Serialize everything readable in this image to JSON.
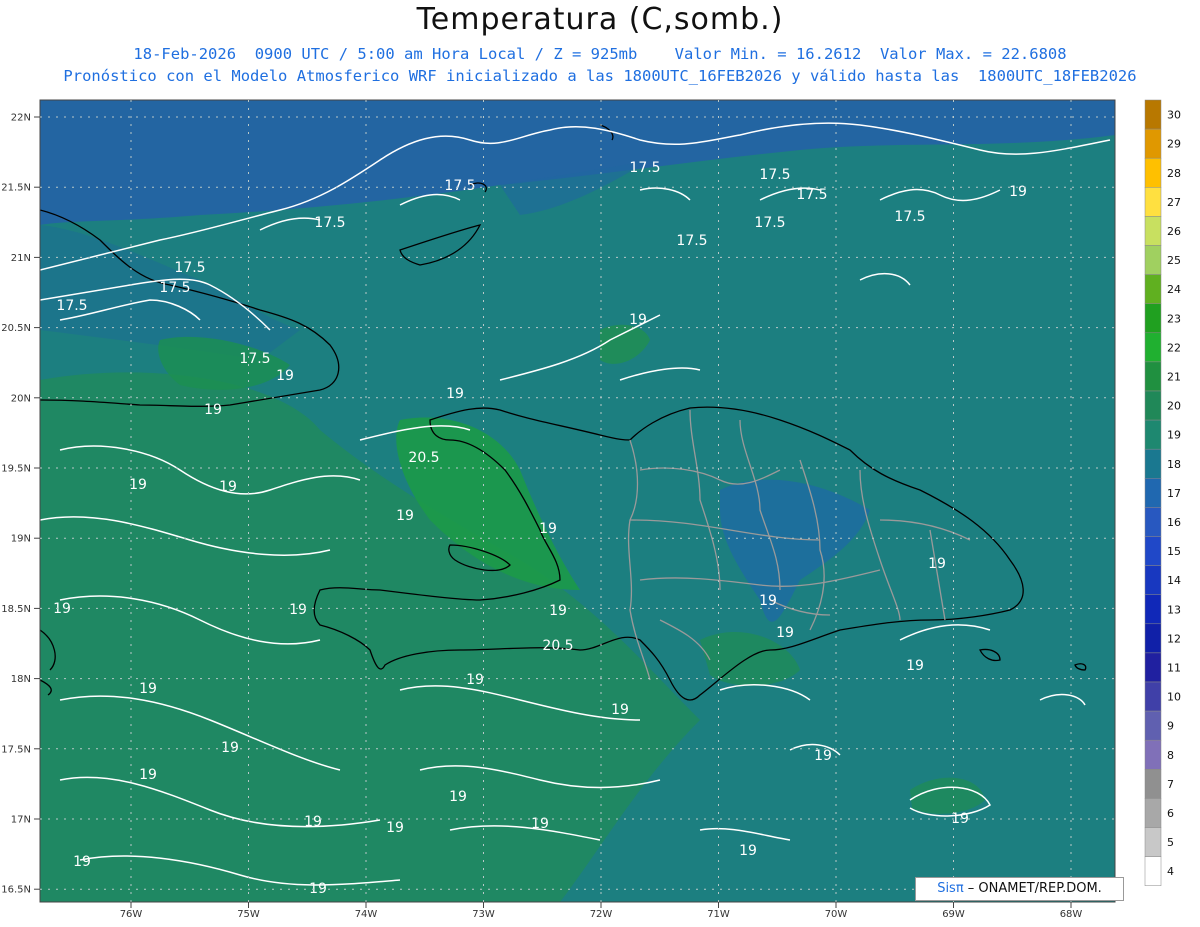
{
  "header": {
    "title": "Temperatura (C,somb.)",
    "subtitle1": "18-Feb-2026  0900 UTC / 5:00 am Hora Local / Z = 925mb    Valor Min. = 16.2612  Valor Max. = 22.6808",
    "subtitle2": "Pronóstico con el Modelo Atmosferico WRF inicializado a las 1800UTC_16FEB2026 y válido hasta las  1800UTC_18FEB2026"
  },
  "axes": {
    "lat_labels": [
      "22N",
      "21.5N",
      "21N",
      "20.5N",
      "20N",
      "19.5N",
      "19N",
      "18.5N",
      "18N",
      "17.5N",
      "17N",
      "16.5N"
    ],
    "lon_labels": [
      "76W",
      "75W",
      "74W",
      "73W",
      "72W",
      "71W",
      "70W",
      "69W",
      "68W"
    ]
  },
  "colorbar": {
    "levels": [
      "30",
      "29",
      "28",
      "27",
      "26",
      "25",
      "24",
      "23",
      "22",
      "21",
      "20",
      "19",
      "18",
      "17",
      "16",
      "15",
      "14",
      "13",
      "12",
      "11",
      "10",
      "9",
      "8",
      "7",
      "6",
      "5",
      "4"
    ],
    "colors": [
      "#b87800",
      "#e09800",
      "#ffc000",
      "#ffe040",
      "#c8e060",
      "#a0d060",
      "#60b020",
      "#20a020",
      "#20b030",
      "#209040",
      "#208858",
      "#1e8870",
      "#1a7890",
      "#2068b0",
      "#2858c0",
      "#2048c8",
      "#1838c0",
      "#1028b8",
      "#1020a8",
      "#2020a0",
      "#4040a8",
      "#6060b0",
      "#8070b8",
      "#909090",
      "#a8a8a8",
      "#c8c8c8",
      "#ffffff"
    ]
  },
  "contours": {
    "labels": [
      "17.5",
      "17.5",
      "17.5",
      "17.5",
      "17.5",
      "17.5",
      "17.5",
      "17.5",
      "17.5",
      "17.5",
      "17.5",
      "17.5",
      "19",
      "19",
      "19",
      "19",
      "19",
      "19",
      "19",
      "19",
      "19",
      "19",
      "19",
      "19",
      "19",
      "19",
      "19",
      "19",
      "19",
      "19",
      "19",
      "19",
      "19",
      "19",
      "19",
      "19",
      "19",
      "19",
      "19",
      "19",
      "20.5"
    ]
  },
  "credit": {
    "sis": "Sisπ",
    "rest": " – ONAMET/REP.DOM."
  }
}
